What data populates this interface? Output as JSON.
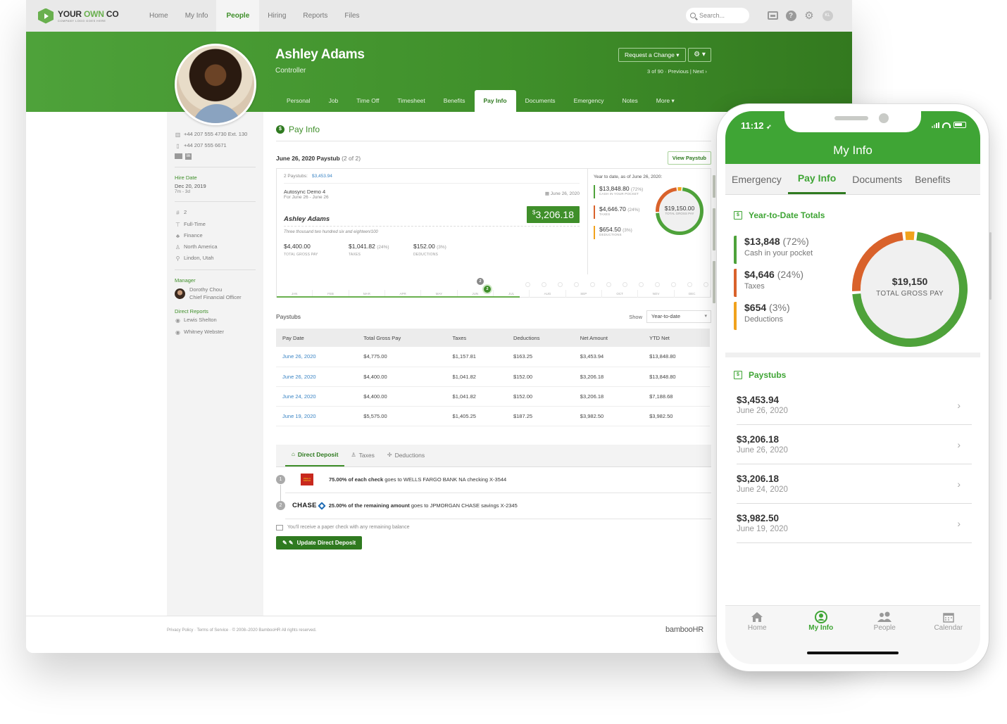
{
  "topnav": {
    "logo_main_1": "YOUR ",
    "logo_main_2": "OWN",
    "logo_main_3": " CO",
    "logo_sub": "COMPANY LOGO GOES HERE",
    "links": [
      "Home",
      "My Info",
      "People",
      "Hiring",
      "Reports",
      "Files"
    ],
    "active_link": "People",
    "search_placeholder": "Search...",
    "user_initials": "KL"
  },
  "profile": {
    "name": "Ashley Adams",
    "title": "Controller",
    "request_change_label": "Request a Change ▾",
    "gear_label": "⚙ ▾",
    "pager": "3 of 90 · Previous | Next ›",
    "tabs": [
      "Personal",
      "Job",
      "Time Off",
      "Timesheet",
      "Benefits",
      "Pay Info",
      "Documents",
      "Emergency",
      "Notes",
      "More ▾"
    ],
    "active_tab": "Pay Info"
  },
  "left_panel": {
    "work_phone": "+44 207 555 4730  Ext. 130",
    "mobile_phone": "+44 207 555 6671",
    "hire_date_label": "Hire Date",
    "hire_date": "Dec 20, 2019",
    "tenure": "7m - 3d",
    "employee_number": "2",
    "employment_status": "Full-Time",
    "department": "Finance",
    "division": "North America",
    "location": "Lindon, Utah",
    "manager_label": "Manager",
    "manager_name": "Dorothy Chou",
    "manager_title": "Chief Financial Officer",
    "direct_reports_label": "Direct Reports",
    "direct_reports": [
      "Lewis Shelton",
      "Whitney Webster"
    ]
  },
  "pay_info": {
    "section_title": "Pay Info",
    "paystub_title": "June 26, 2020 Paystub",
    "paystub_count": "(2 of 2)",
    "view_paystub_label": "View Paystub",
    "stub": {
      "paystubs_label": "2 Paystubs:",
      "paystubs_total": "$3,453.94",
      "company": "Autosync Demo 4",
      "period": "For June 26 - June 26",
      "date": "▦ June 26, 2020",
      "net_currency": "$",
      "net_amount": "3,206.18",
      "payee": "Ashley Adams",
      "amount_words": "Three thousand two hundred six and eighteen/100",
      "gross": "$4,400.00",
      "gross_label": "TOTAL GROSS PAY",
      "taxes": "$1,041.82",
      "taxes_pct": "(24%)",
      "taxes_label": "TAXES",
      "deductions": "$152.00",
      "deductions_pct": "(3%)",
      "deductions_label": "DEDUCTIONS"
    },
    "ytd": {
      "caption": "Year to date, as of June 26, 2020:",
      "items": [
        {
          "value": "$13,848.80",
          "pct": "(72%)",
          "label": "CASH IN YOUR POCKET",
          "color": "#4ea23a"
        },
        {
          "value": "$4,646.70",
          "pct": "(24%)",
          "label": "TAXES",
          "color": "#d9622b"
        },
        {
          "value": "$654.50",
          "pct": "(3%)",
          "label": "DEDUCTIONS",
          "color": "#f1a21c"
        }
      ],
      "total": "$19,150.00",
      "total_label": "TOTAL GROSS PAY"
    },
    "timeline": {
      "months": [
        "JAN",
        "FEB",
        "MAR",
        "APR",
        "MAY",
        "JUN",
        "JUL",
        "AUG",
        "SEP",
        "OCT",
        "NOV",
        "DEC"
      ],
      "bubble_gray": "2",
      "bubble_green": "2",
      "progress_fraction": 0.56
    }
  },
  "paystubs": {
    "title": "Paystubs",
    "show_label": "Show",
    "show_value": "Year-to-date",
    "columns": [
      "Pay Date",
      "Total Gross Pay",
      "Taxes",
      "Deductions",
      "Net Amount",
      "YTD Net"
    ],
    "rows": [
      [
        "June 26, 2020",
        "$4,775.00",
        "$1,157.81",
        "$163.25",
        "$3,453.94",
        "$13,848.80"
      ],
      [
        "June 26, 2020",
        "$4,400.00",
        "$1,041.82",
        "$152.00",
        "$3,206.18",
        "$13,848.80"
      ],
      [
        "June 24, 2020",
        "$4,400.00",
        "$1,041.82",
        "$152.00",
        "$3,206.18",
        "$7,188.68"
      ],
      [
        "June 19, 2020",
        "$5,575.00",
        "$1,405.25",
        "$187.25",
        "$3,982.50",
        "$3,982.50"
      ]
    ]
  },
  "deposit": {
    "tabs": [
      "Direct Deposit",
      "Taxes",
      "Deductions"
    ],
    "active_tab": "Direct Deposit",
    "rows": [
      {
        "num": "1",
        "bold": "75.00% of each check",
        "rest": " goes to WELLS FARGO BANK NA checking X-3544",
        "bank": "WELLS FARGO"
      },
      {
        "num": "2",
        "bold": "25.00% of the remaining amount",
        "rest": " goes to JPMORGAN CHASE savings X-2345",
        "bank": "CHASE"
      }
    ],
    "paper_note": "You'll receive a paper check with any remaining balance",
    "update_label": "Update Direct Deposit"
  },
  "footer": {
    "text": "Privacy Policy  ·  Terms of Service  ·  © 2008–2020 BambooHR All rights reserved.",
    "brand": "bambooHR"
  },
  "phone": {
    "time": "11:12",
    "title": "My Info",
    "tabs": [
      "Emergency",
      "Pay Info",
      "Documents",
      "Benefits"
    ],
    "active_tab": "Pay Info",
    "ytd_title": "Year-to-Date Totals",
    "ytd_items": [
      {
        "value": "$13,848",
        "pct": "(72%)",
        "label": "Cash in your pocket",
        "color": "#4ea23a"
      },
      {
        "value": "$4,646",
        "pct": "(24%)",
        "label": "Taxes",
        "color": "#d9622b"
      },
      {
        "value": "$654",
        "pct": "(3%)",
        "label": "Deductions",
        "color": "#f1a21c"
      }
    ],
    "total": "$19,150",
    "total_label": "TOTAL GROSS PAY",
    "paystubs_title": "Paystubs",
    "paystubs": [
      {
        "amount": "$3,453.94",
        "date": "June 26, 2020"
      },
      {
        "amount": "$3,206.18",
        "date": "June 26, 2020"
      },
      {
        "amount": "$3,206.18",
        "date": "June 24, 2020"
      },
      {
        "amount": "$3,982.50",
        "date": "June 19, 2020"
      }
    ],
    "bottom_nav": [
      "Home",
      "My Info",
      "People",
      "Calendar"
    ],
    "active_nav": "My Info"
  },
  "chart_data": [
    {
      "type": "pie",
      "title": "Year to date, as of June 26, 2020",
      "categories": [
        "Cash in your pocket",
        "Taxes",
        "Deductions"
      ],
      "values": [
        13848.8,
        4646.7,
        654.5
      ],
      "percentages": [
        72,
        24,
        3
      ],
      "center_label": "$19,150.00 TOTAL GROSS PAY",
      "colors": [
        "#4ea23a",
        "#d9622b",
        "#f1a21c"
      ]
    },
    {
      "type": "pie",
      "title": "Year-to-Date Totals",
      "categories": [
        "Cash in your pocket",
        "Taxes",
        "Deductions"
      ],
      "values": [
        13848,
        4646,
        654
      ],
      "percentages": [
        72,
        24,
        3
      ],
      "center_label": "$19,150 TOTAL GROSS PAY",
      "colors": [
        "#4ea23a",
        "#d9622b",
        "#f1a21c"
      ]
    }
  ]
}
